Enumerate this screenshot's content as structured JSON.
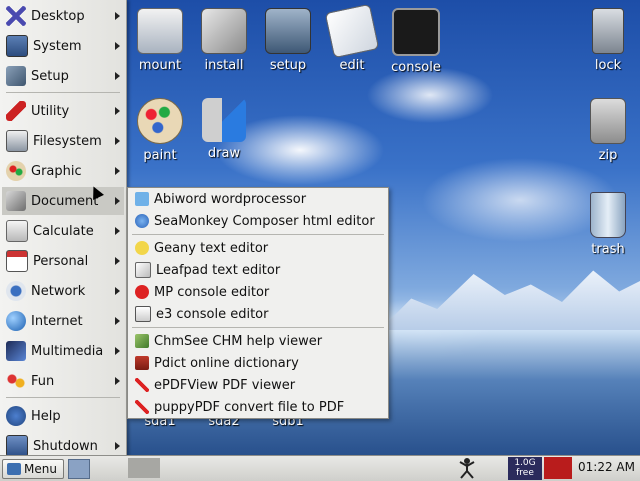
{
  "desktop_icons": {
    "mount": "mount",
    "install": "install",
    "setup": "setup",
    "edit": "edit",
    "console": "console",
    "lock": "lock",
    "paint": "paint",
    "draw": "draw",
    "zip": "zip",
    "trash": "trash",
    "sda1": "sda1",
    "sda2": "sda2",
    "sdb1": "sdb1"
  },
  "main_menu": {
    "items": [
      {
        "label": "Desktop"
      },
      {
        "label": "System"
      },
      {
        "label": "Setup"
      },
      {
        "label": "Utility"
      },
      {
        "label": "Filesystem"
      },
      {
        "label": "Graphic"
      },
      {
        "label": "Document"
      },
      {
        "label": "Calculate"
      },
      {
        "label": "Personal"
      },
      {
        "label": "Network"
      },
      {
        "label": "Internet"
      },
      {
        "label": "Multimedia"
      },
      {
        "label": "Fun"
      },
      {
        "label": "Help"
      },
      {
        "label": "Shutdown"
      }
    ]
  },
  "document_submenu": {
    "items": [
      {
        "label": "Abiword wordprocessor"
      },
      {
        "label": "SeaMonkey Composer html editor"
      },
      {
        "label": "Geany text editor"
      },
      {
        "label": "Leafpad text editor"
      },
      {
        "label": "MP console editor"
      },
      {
        "label": "e3 console editor"
      },
      {
        "label": "ChmSee CHM help viewer"
      },
      {
        "label": "Pdict online dictionary"
      },
      {
        "label": "ePDFView PDF viewer"
      },
      {
        "label": "puppyPDF convert file to PDF"
      }
    ]
  },
  "taskbar": {
    "menu_label": "Menu",
    "free_size": "1.0G",
    "free_label": "free",
    "clock": "01:22 AM"
  },
  "colors": {
    "menu_bg": "#e8e8e5",
    "menu_active": "#c9c9c4",
    "sky": "#2a5fb8",
    "free_bar": "#b91c1c"
  }
}
